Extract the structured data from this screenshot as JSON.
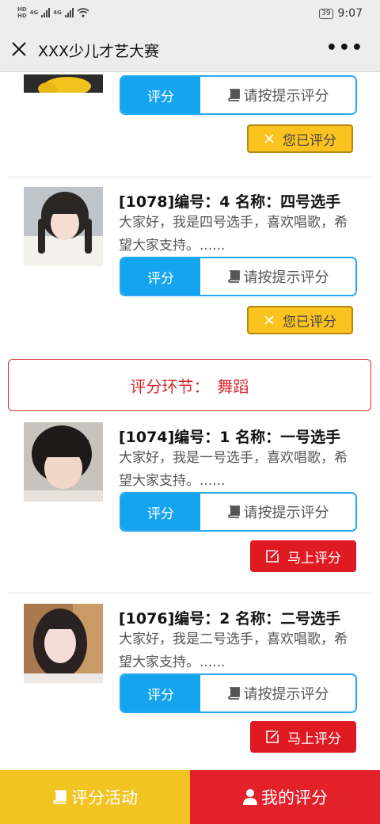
{
  "status_bar": {
    "sim1": "HD",
    "sim2": "HD",
    "net1": "4G",
    "net2": "4G",
    "battery": "39",
    "time": "9:07"
  },
  "navbar": {
    "title": "XXX少儿才艺大赛",
    "more": "•••"
  },
  "score_label": "评分",
  "hint_label": "请按提示评分",
  "done_label": "您已评分",
  "go_label": "马上评分",
  "section": {
    "label": "评分环节：",
    "name": "舞蹈"
  },
  "entries": [
    {
      "title": "[1078]编号：4 名称：四号选手",
      "desc": "大家好，我是四号选手，喜欢唱歌，希望大家支持。......"
    },
    {
      "title": "[1074]编号：1 名称：一号选手",
      "desc": "大家好，我是一号选手，喜欢唱歌，希望大家支持。......"
    },
    {
      "title": "[1076]编号：2 名称：二号选手",
      "desc": "大家好，我是二号选手，喜欢唱歌，希望大家支持。......"
    }
  ],
  "footer": {
    "activity": "评分活动",
    "mine": "我的评分"
  },
  "colors": {
    "blue": "#14a4f0",
    "yellow": "#fbc320",
    "red": "#e01a22",
    "footer_yellow": "#f2c421",
    "footer_red": "#e3212b"
  }
}
